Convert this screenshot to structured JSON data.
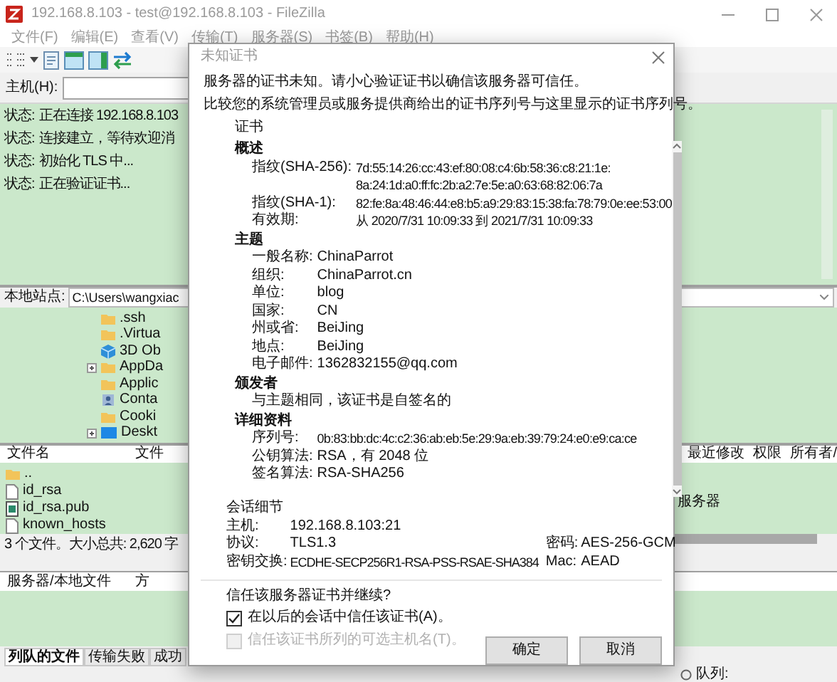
{
  "window": {
    "title": "192.168.8.103 - test@192.168.8.103 - FileZilla"
  },
  "menu": [
    "文件(F)",
    "编辑(E)",
    "查看(V)",
    "传输(T)",
    "服务器(S)",
    "书签(B)",
    "帮助(H)"
  ],
  "quickconnect": {
    "label": "主机(H):"
  },
  "message_log": [
    {
      "label": "状态:",
      "text": "正在连接 192.168.8.103"
    },
    {
      "label": "状态:",
      "text": "连接建立，等待欢迎消"
    },
    {
      "label": "状态:",
      "text": "初始化 TLS 中..."
    },
    {
      "label": "状态:",
      "text": "正在验证证书..."
    }
  ],
  "local_site": {
    "label": "本地站点:",
    "path": "C:\\Users\\wangxiac"
  },
  "local_tree": [
    {
      "name": ".ssh",
      "kind": "folder",
      "expandable": false
    },
    {
      "name": ".Virtua",
      "kind": "folder",
      "expandable": false
    },
    {
      "name": "3D Ob",
      "kind": "object3d",
      "expandable": false
    },
    {
      "name": "AppDa",
      "kind": "folder",
      "expandable": true
    },
    {
      "name": "Applic",
      "kind": "folder",
      "expandable": false
    },
    {
      "name": "Conta",
      "kind": "contacts",
      "expandable": false
    },
    {
      "name": "Cooki",
      "kind": "folder",
      "expandable": false
    },
    {
      "name": "Deskt",
      "kind": "desktop",
      "expandable": true
    }
  ],
  "local_files": {
    "columns": [
      "文件名",
      "文件"
    ],
    "rows": [
      {
        "name": "..",
        "kind": "folder"
      },
      {
        "name": "id_rsa",
        "kind": "file"
      },
      {
        "name": "id_rsa.pub",
        "kind": "key"
      },
      {
        "name": "known_hosts",
        "kind": "file"
      }
    ]
  },
  "local_status": "3 个文件。大小总共: 2,620 字",
  "remote_files": {
    "columns": [
      "最近修改",
      "权限",
      "所有者/"
    ],
    "message": "服务器"
  },
  "queue": {
    "columns": [
      "服务器/本地文件",
      "方"
    ]
  },
  "queue_tabs": [
    {
      "label": "列队的文件",
      "selected": true
    },
    {
      "label": "传输失败",
      "selected": false
    },
    {
      "label": "成功",
      "selected": false
    }
  ],
  "status_bar": {
    "queue": "队列:"
  },
  "dialog": {
    "title": "未知证书",
    "messages": [
      "服务器的证书未知。请小心验证证书以确信该服务器可信任。",
      "比较您的系统管理员或服务提供商给出的证书序列号与这里显示的证书序列号。"
    ],
    "certificate_heading": "证书",
    "sections": [
      {
        "title": "概述",
        "fields": [
          {
            "label": "指纹(SHA-256):",
            "value_lines": [
              "7d:55:14:26:cc:43:ef:80:08:c4:6b:58:36:c8:21:1e:",
              "8a:24:1d:a0:ff:fc:2b:a2:7e:5e:a0:63:68:82:06:7a"
            ]
          },
          {
            "label": "指纹(SHA-1):",
            "value_lines": [
              "82:fe:8a:48:46:44:e8:b5:a9:29:83:15:38:fa:78:79:0e:ee:53:00"
            ]
          },
          {
            "label": "有效期:",
            "value_lines": [
              "从 2020/7/31 10:09:33 到 2021/7/31 10:09:33"
            ]
          }
        ]
      },
      {
        "title": "主题",
        "fields": [
          {
            "label": "一般名称:",
            "value_lines": [
              "ChinaParrot"
            ]
          },
          {
            "label": "组织:",
            "value_lines": [
              "ChinaParrot.cn"
            ]
          },
          {
            "label": "单位:",
            "value_lines": [
              "blog"
            ]
          },
          {
            "label": "国家:",
            "value_lines": [
              "CN"
            ]
          },
          {
            "label": "州或省:",
            "value_lines": [
              "BeiJing"
            ]
          },
          {
            "label": "地点:",
            "value_lines": [
              "BeiJing"
            ]
          },
          {
            "label": "电子邮件:",
            "value_lines": [
              "1362832155@qq.com"
            ]
          }
        ]
      },
      {
        "title": "颁发者",
        "note": "与主题相同，该证书是自签名的"
      },
      {
        "title": "详细资料",
        "fields": [
          {
            "label": "序列号:",
            "value_lines": [
              "0b:83:bb:dc:4c:c2:36:ab:eb:5e:29:9a:eb:39:79:24:e0:e9:ca:ce"
            ]
          },
          {
            "label": "公钥算法:",
            "value_lines": [
              "RSA，有 2048 位"
            ]
          },
          {
            "label": "签名算法:",
            "value_lines": [
              "RSA-SHA256"
            ]
          }
        ]
      }
    ],
    "session": {
      "heading": "会话细节",
      "host": {
        "label": "主机:",
        "value": "192.168.8.103:21"
      },
      "protocol": {
        "label": "协议:",
        "value": "TLS1.3"
      },
      "cipher": {
        "label": "密码:",
        "value": "AES-256-GCM"
      },
      "key_exchange": {
        "label": "密钥交换:",
        "value": "ECDHE-SECP256R1-RSA-PSS-RSAE-SHA384"
      },
      "mac": {
        "label": "Mac:",
        "value": "AEAD"
      }
    },
    "question": "信任该服务器证书并继续?",
    "options": [
      {
        "label": "在以后的会话中信任该证书(A)。",
        "checked": true,
        "disabled": false
      },
      {
        "label": "信任该证书所列的可选主机名(T)。",
        "checked": false,
        "disabled": true
      }
    ],
    "buttons": [
      "确定",
      "取消"
    ]
  }
}
